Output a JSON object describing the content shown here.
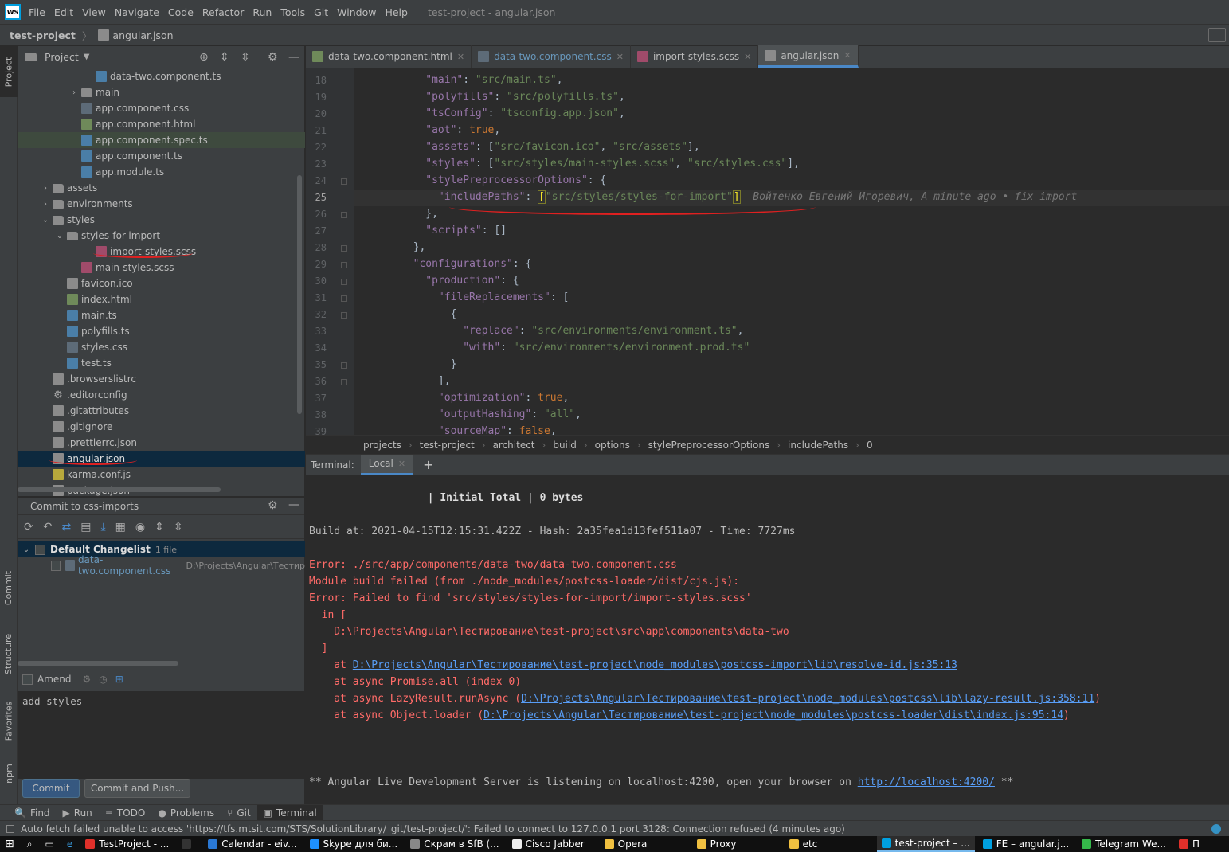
{
  "app": {
    "menu": [
      "File",
      "Edit",
      "View",
      "Navigate",
      "Code",
      "Refactor",
      "Run",
      "Tools",
      "Git",
      "Window",
      "Help"
    ],
    "window_title": "test-project - angular.json",
    "logo": "WS"
  },
  "navbar": {
    "project": "test-project",
    "file": "angular.json"
  },
  "left_strip": {
    "project": "Project",
    "commit": "Commit",
    "structure": "Structure",
    "favorites": "Favorites",
    "npm": "npm"
  },
  "project_panel": {
    "title": "Project",
    "rows": [
      {
        "label": "data-two.component.ts",
        "icon": "ts",
        "indent": 5
      },
      {
        "label": "main",
        "icon": "folder",
        "indent": 4,
        "chev": "›"
      },
      {
        "label": "app.component.css",
        "icon": "css",
        "indent": 4
      },
      {
        "label": "app.component.html",
        "icon": "html",
        "indent": 4
      },
      {
        "label": "app.component.spec.ts",
        "icon": "ts",
        "indent": 4,
        "hl": true
      },
      {
        "label": "app.component.ts",
        "icon": "ts",
        "indent": 4
      },
      {
        "label": "app.module.ts",
        "icon": "ts",
        "indent": 4
      },
      {
        "label": "assets",
        "icon": "folder",
        "indent": 2,
        "chev": "›"
      },
      {
        "label": "environments",
        "icon": "folder",
        "indent": 2,
        "chev": "›"
      },
      {
        "label": "styles",
        "icon": "folder",
        "indent": 2,
        "chev": "⌄"
      },
      {
        "label": "styles-for-import",
        "icon": "folder",
        "indent": 3,
        "chev": "⌄"
      },
      {
        "label": "import-styles.scss",
        "icon": "scss",
        "indent": 5
      },
      {
        "label": "main-styles.scss",
        "icon": "scss",
        "indent": 4
      },
      {
        "label": "favicon.ico",
        "icon": "file",
        "indent": 3
      },
      {
        "label": "index.html",
        "icon": "html",
        "indent": 3
      },
      {
        "label": "main.ts",
        "icon": "ts",
        "indent": 3
      },
      {
        "label": "polyfills.ts",
        "icon": "ts",
        "indent": 3
      },
      {
        "label": "styles.css",
        "icon": "css",
        "indent": 3
      },
      {
        "label": "test.ts",
        "icon": "ts",
        "indent": 3
      },
      {
        "label": ".browserslistrc",
        "icon": "file",
        "indent": 2
      },
      {
        "label": ".editorconfig",
        "icon": "gear",
        "indent": 2
      },
      {
        "label": ".gitattributes",
        "icon": "file",
        "indent": 2
      },
      {
        "label": ".gitignore",
        "icon": "file",
        "indent": 2
      },
      {
        "label": ".prettierrc.json",
        "icon": "json",
        "indent": 2
      },
      {
        "label": "angular.json",
        "icon": "json",
        "indent": 2,
        "sel": true
      },
      {
        "label": "karma.conf.js",
        "icon": "js",
        "indent": 2
      },
      {
        "label": "package.json",
        "icon": "json",
        "indent": 2
      }
    ]
  },
  "commit_panel": {
    "title": "Commit to css-imports",
    "changelist": "Default Changelist",
    "changelist_count": "1 file",
    "file": "data-two.component.css",
    "file_path": "D:\\Projects\\Angular\\Тестир",
    "amend": "Amend",
    "message": "add styles",
    "commit_btn": "Commit",
    "commit_push_btn": "Commit and Push..."
  },
  "tabs": [
    {
      "label": "data-two.component.html",
      "icon": "html"
    },
    {
      "label": "data-two.component.css",
      "icon": "css",
      "color": "#6897bb"
    },
    {
      "label": "import-styles.scss",
      "icon": "scss"
    },
    {
      "label": "angular.json",
      "icon": "json",
      "active": true
    }
  ],
  "editor": {
    "line_numbers": [
      "18",
      "19",
      "20",
      "21",
      "22",
      "23",
      "24",
      "25",
      "26",
      "27",
      "28",
      "29",
      "30",
      "31",
      "32",
      "33",
      "34",
      "35",
      "36",
      "37",
      "38",
      "39"
    ],
    "current_line": "25",
    "blame": "Войтенко Евгений Игоревич, A minute ago • fix import"
  },
  "breadcrumbs": [
    "projects",
    "test-project",
    "architect",
    "build",
    "options",
    "stylePreprocessorOptions",
    "includePaths",
    "0"
  ],
  "terminal": {
    "label": "Terminal:",
    "tab": "Local",
    "add": "+",
    "lines": [
      {
        "t": "                   | Initial Total | 0 bytes",
        "c": "bold"
      },
      {
        "t": "",
        "c": ""
      },
      {
        "t": "Build at: 2021-04-15T12:15:31.422Z - Hash: 2a35fea1d13fef511a07 - Time: 7727ms",
        "c": ""
      },
      {
        "t": "",
        "c": ""
      },
      {
        "t": "Error: ./src/app/components/data-two/data-two.component.css",
        "c": "err"
      },
      {
        "t": "Module build failed (from ./node_modules/postcss-loader/dist/cjs.js):",
        "c": "err"
      },
      {
        "t": "Error: Failed to find 'src/styles/styles-for-import/import-styles.scss'",
        "c": "err"
      },
      {
        "t": "  in [",
        "c": "err"
      },
      {
        "t": "    D:\\Projects\\Angular\\Тестирование\\test-project\\src\\app\\components\\data-two",
        "c": "err"
      },
      {
        "t": "  ]",
        "c": "err"
      }
    ],
    "stack": [
      {
        "pre": "    at ",
        "link": "D:\\Projects\\Angular\\Тестирование\\test-project\\node_modules\\postcss-import\\lib\\resolve-id.js:35:13",
        "post": ""
      },
      {
        "pre": "    at async Promise.all (index 0)",
        "link": "",
        "post": ""
      },
      {
        "pre": "    at async LazyResult.runAsync (",
        "link": "D:\\Projects\\Angular\\Тестирование\\test-project\\node_modules\\postcss\\lib\\lazy-result.js:358:11",
        "post": ")"
      },
      {
        "pre": "    at async Object.loader (",
        "link": "D:\\Projects\\Angular\\Тестирование\\test-project\\node_modules\\postcss-loader\\dist\\index.js:95:14",
        "post": ")"
      }
    ],
    "server_pre": "** Angular Live Development Server is listening on localhost:4200, open your browser on ",
    "server_link": "http://localhost:4200/",
    "server_post": " **"
  },
  "toolwindows": [
    {
      "icon": "🔍",
      "label": "Find"
    },
    {
      "icon": "▶",
      "label": "Run"
    },
    {
      "icon": "≡",
      "label": "TODO"
    },
    {
      "icon": "●",
      "label": "Problems"
    },
    {
      "icon": "⑂",
      "label": "Git"
    },
    {
      "icon": "▣",
      "label": "Terminal",
      "active": true
    }
  ],
  "status": "Auto fetch failed unable to access 'https://tfs.mtsit.com/STS/SolutionLibrary/_git/test-project/': Failed to connect to 127.0.0.1 port 3128: Connection refused (4 minutes ago)",
  "taskbar": [
    {
      "label": "TestProject - ...",
      "color": "#e0302a"
    },
    {
      "label": "",
      "color": "#333"
    },
    {
      "label": "Calendar - eiv...",
      "color": "#2a78d4"
    },
    {
      "label": "Skype для би...",
      "color": "#1e90ff"
    },
    {
      "label": "Скрам в SfB (...",
      "color": "#888"
    },
    {
      "label": "Cisco Jabber",
      "color": "#eee"
    },
    {
      "label": "Opera",
      "color": "#f0c040"
    },
    {
      "label": "Proxy",
      "color": "#f0c040"
    },
    {
      "label": "etc",
      "color": "#f0c040"
    },
    {
      "label": "test-project – ...",
      "color": "#00a0e0",
      "active": true
    },
    {
      "label": "FE – angular.j...",
      "color": "#00a0e0"
    },
    {
      "label": "Telegram We...",
      "color": "#35b84a"
    },
    {
      "label": "П",
      "color": "#e0302a"
    }
  ]
}
